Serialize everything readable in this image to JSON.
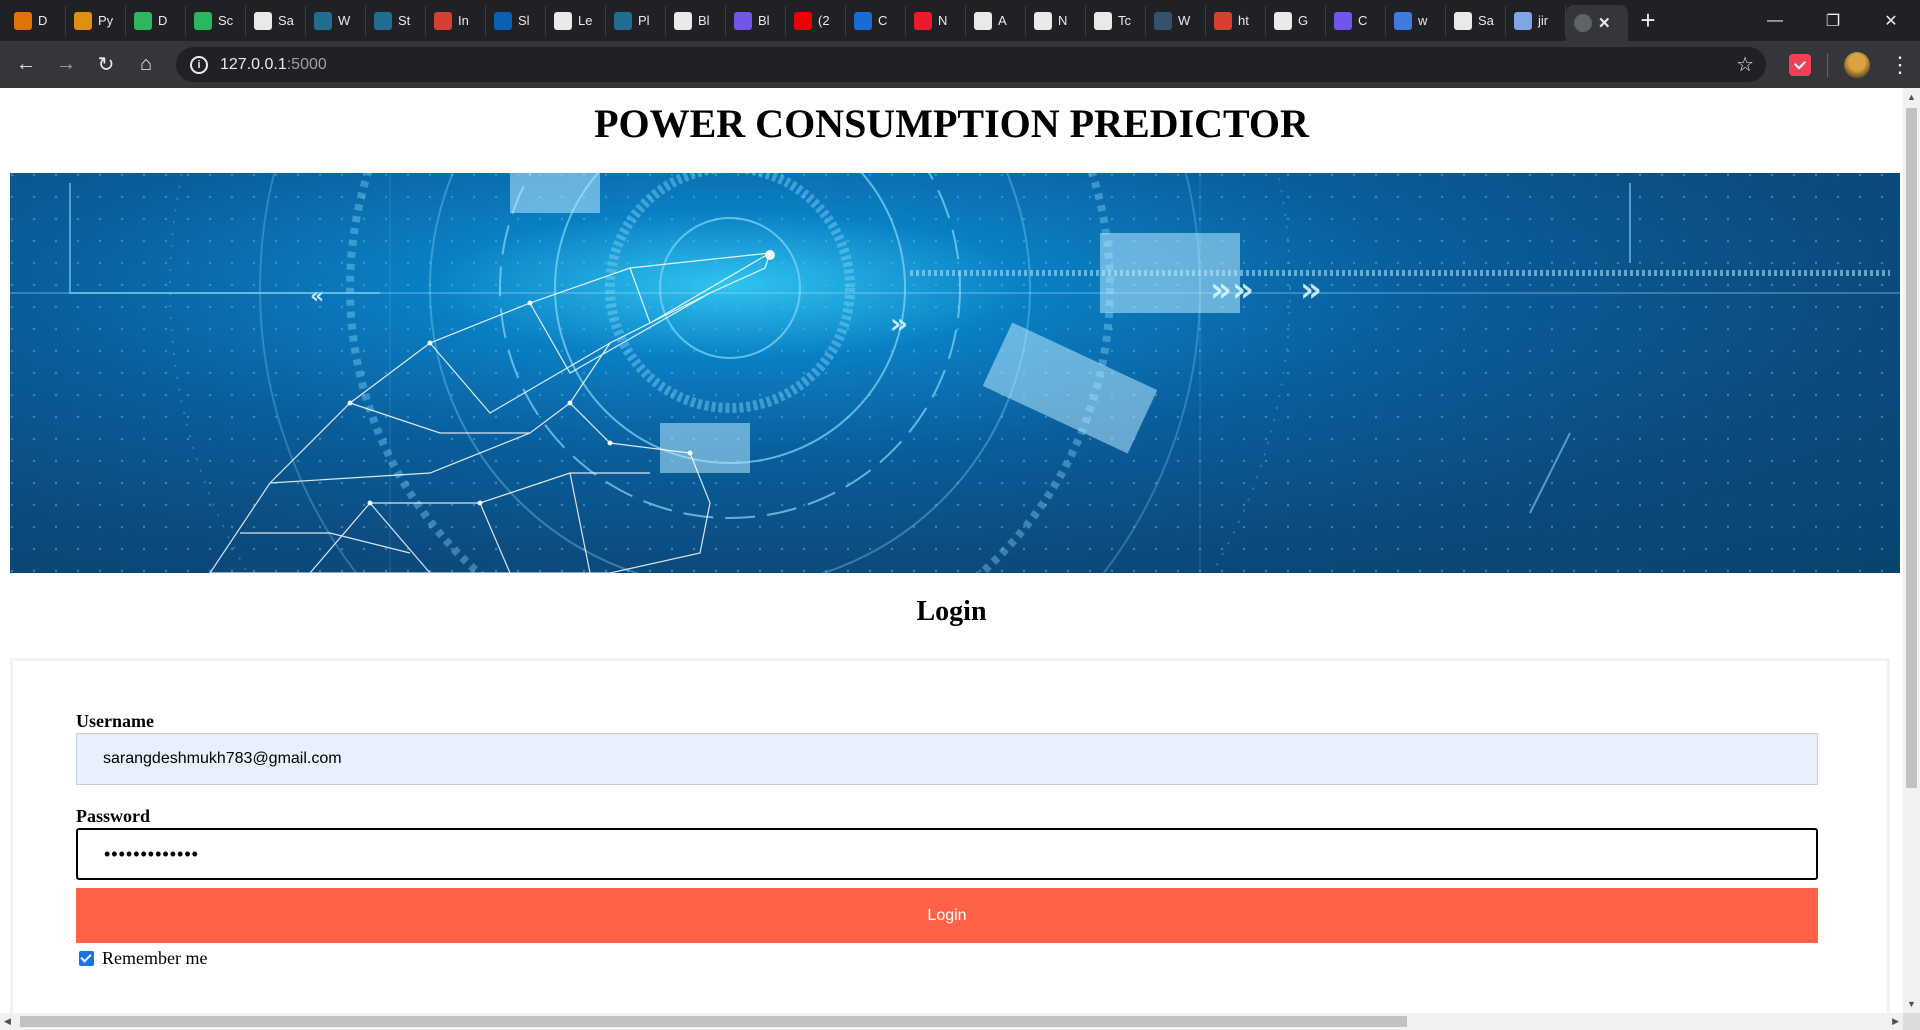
{
  "browser": {
    "tabs": [
      {
        "label": "D",
        "icon": "loading-ring-icon",
        "color": "#f57c00"
      },
      {
        "label": "Py",
        "icon": "notebook-icon",
        "color": "#f39c12"
      },
      {
        "label": "D",
        "icon": "hackerrank-icon",
        "color": "#2ec866"
      },
      {
        "label": "Sc",
        "icon": "hackerrank-icon",
        "color": "#2ec866"
      },
      {
        "label": "Sa",
        "icon": "github-icon",
        "color": "#ffffff"
      },
      {
        "label": "W",
        "icon": "wordpress-icon",
        "color": "#21759b"
      },
      {
        "label": "St",
        "icon": "wordpress-icon",
        "color": "#21759b"
      },
      {
        "label": "In",
        "icon": "gmail-icon",
        "color": "#ea4335"
      },
      {
        "label": "Sl",
        "icon": "linkedin-icon",
        "color": "#0a66c2"
      },
      {
        "label": "Le",
        "icon": "pen-icon",
        "color": "#ffffff"
      },
      {
        "label": "Pl",
        "icon": "wordpress-icon",
        "color": "#21759b"
      },
      {
        "label": "Bl",
        "icon": "chart-icon",
        "color": "#ffffff"
      },
      {
        "label": "Bl",
        "icon": "c-logo-icon",
        "color": "#7b5cff"
      },
      {
        "label": "(2",
        "icon": "youtube-icon",
        "color": "#ff0000"
      },
      {
        "label": "C",
        "icon": "k-logo-icon",
        "color": "#1a73e8"
      },
      {
        "label": "N",
        "icon": "opera-icon",
        "color": "#ff1b2d"
      },
      {
        "label": "A",
        "icon": "amazon-icon",
        "color": "#ffffff"
      },
      {
        "label": "N",
        "icon": "amazon-icon",
        "color": "#ffffff"
      },
      {
        "label": "Tc",
        "icon": "medium-icon",
        "color": "#ffffff"
      },
      {
        "label": "W",
        "icon": "tds-icon",
        "color": "#355876"
      },
      {
        "label": "ht",
        "icon": "gmail-icon",
        "color": "#ea4335"
      },
      {
        "label": "G",
        "icon": "github-icon",
        "color": "#ffffff"
      },
      {
        "label": "C",
        "icon": "c-logo-icon",
        "color": "#7b5cff"
      },
      {
        "label": "w",
        "icon": "google-icon",
        "color": "#4285f4"
      },
      {
        "label": "Sa",
        "icon": "github-icon",
        "color": "#ffffff"
      },
      {
        "label": "jir",
        "icon": "terminal-icon",
        "color": "#8ab4f8"
      }
    ],
    "active_tab_close": "✕",
    "new_tab": "+",
    "window_controls": {
      "minimize": "—",
      "restore": "❐",
      "close": "✕"
    },
    "nav": {
      "back": "←",
      "forward": "→",
      "reload": "↻",
      "home": "⌂"
    },
    "url_host": "127.0.0.1",
    "url_port": ":5000",
    "info_icon_glyph": "i",
    "bookmark_star": "☆",
    "menu_glyph": "⋮"
  },
  "page": {
    "title": "POWER CONSUMPTION PREDICTOR",
    "login_heading": "Login",
    "username_label": "Username",
    "username_value": "sarangdeshmukh783@gmail.com",
    "password_label": "Password",
    "password_value": "•••••••••••••",
    "login_button": "Login",
    "remember_label": "Remember me",
    "remember_checked": true,
    "accent_button_color": "#ff6347",
    "autofill_color": "#e8f0fe"
  },
  "scrollbars": {
    "up": "▲",
    "down": "▼",
    "left": "◀",
    "right": "▶"
  }
}
